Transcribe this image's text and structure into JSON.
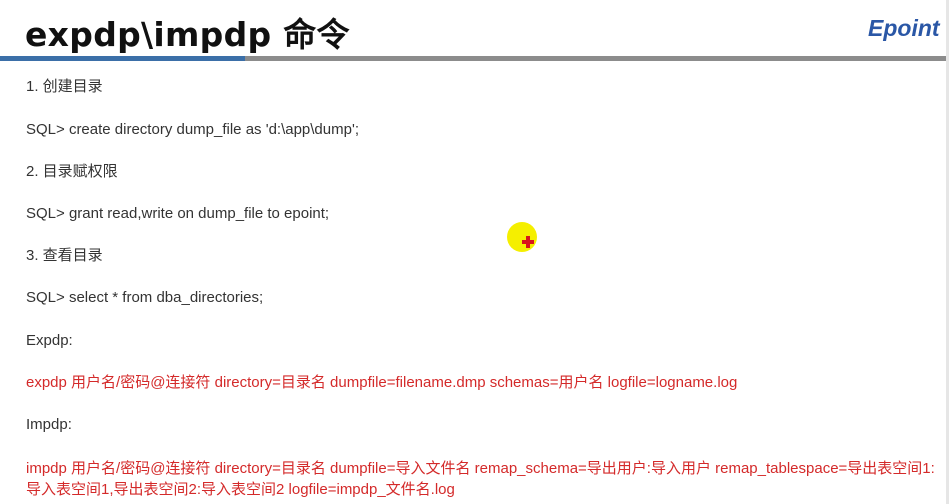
{
  "slide": {
    "title": "expdp\\impdp 命令",
    "logo_text": "Epoint 新",
    "lines": {
      "step1": "1. 创建目录",
      "sql1": "SQL> create directory dump_file as 'd:\\app\\dump';",
      "step2": "2. 目录赋权限",
      "sql2": "SQL> grant read,write on dump_file to epoint;",
      "step3": "3. 查看目录",
      "sql3": "SQL> select * from dba_directories;",
      "expdp_label": "Expdp:",
      "expdp_cmd": "expdp 用户名/密码@连接符 directory=目录名 dumpfile=filename.dmp schemas=用户名 logfile=logname.log",
      "impdp_label": "Impdp:",
      "impdp_cmd": "impdp 用户名/密码@连接符 directory=目录名 dumpfile=导入文件名 remap_schema=导出用户:导入用户  remap_tablespace=导出表空间1:导入表空间1,导出表空间2:导入表空间2 logfile=impdp_文件名.log"
    }
  },
  "colors": {
    "accent_blue": "#3b6fa8",
    "divider_gray": "#8c8c8c",
    "command_red": "#d42a2a",
    "logo_blue": "#2a57a6",
    "cursor_yellow": "#f5ef00"
  },
  "icons": {
    "cursor": "mouse-pointer-highlight-icon"
  }
}
